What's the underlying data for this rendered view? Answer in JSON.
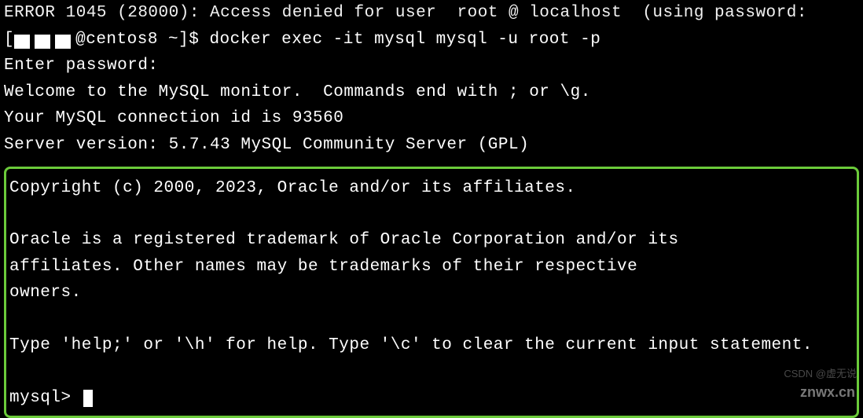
{
  "cutoffTop": "ERROR 1045 (28000): Access denied for user  root @ localhost  (using password:",
  "prompt": {
    "host": "@centos8 ~]$ ",
    "command": "docker exec -it mysql mysql -u root -p"
  },
  "lines": {
    "enterPassword": "Enter password: ",
    "welcome": "Welcome to the MySQL monitor.  Commands end with ; or \\g.",
    "connectionId": "Your MySQL connection id is 93560",
    "serverVersion": "Server version: 5.7.43 MySQL Community Server (GPL)"
  },
  "highlighted": {
    "copyright": "Copyright (c) 2000, 2023, Oracle and/or its affiliates.",
    "trademark1": "Oracle is a registered trademark of Oracle Corporation and/or its",
    "trademark2": "affiliates. Other names may be trademarks of their respective",
    "trademark3": "owners.",
    "help": "Type 'help;' or '\\h' for help. Type '\\c' to clear the current input statement.",
    "mysqlPrompt": "mysql> "
  },
  "watermark": "znwx.cn",
  "watermark2": "CSDN @虚无说"
}
